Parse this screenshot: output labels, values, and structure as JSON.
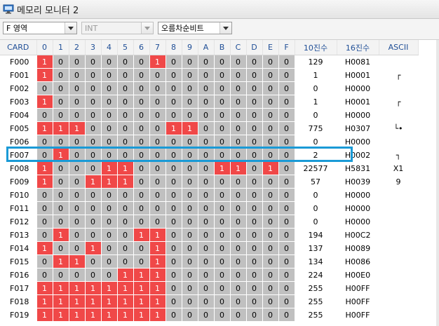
{
  "window": {
    "title": "메모리 모니터 2"
  },
  "toolbar": {
    "area_select": "F 영역",
    "type_select": "INT",
    "sort_select": "오름차순비트"
  },
  "columns": {
    "card": "CARD",
    "bits": [
      "0",
      "1",
      "2",
      "3",
      "4",
      "5",
      "6",
      "7",
      "8",
      "9",
      "A",
      "B",
      "C",
      "D",
      "E",
      "F"
    ],
    "dec": "10진수",
    "hex": "16진수",
    "ascii": "ASCII"
  },
  "rows": [
    {
      "card": "F000",
      "bits": [
        1,
        0,
        0,
        0,
        0,
        0,
        0,
        1,
        0,
        0,
        0,
        0,
        0,
        0,
        0,
        0
      ],
      "dec": "129",
      "hex": "H0081",
      "ascii": ""
    },
    {
      "card": "F001",
      "bits": [
        1,
        0,
        0,
        0,
        0,
        0,
        0,
        0,
        0,
        0,
        0,
        0,
        0,
        0,
        0,
        0
      ],
      "dec": "1",
      "hex": "H0001",
      "ascii": "┌"
    },
    {
      "card": "F002",
      "bits": [
        0,
        0,
        0,
        0,
        0,
        0,
        0,
        0,
        0,
        0,
        0,
        0,
        0,
        0,
        0,
        0
      ],
      "dec": "0",
      "hex": "H0000",
      "ascii": ""
    },
    {
      "card": "F003",
      "bits": [
        1,
        0,
        0,
        0,
        0,
        0,
        0,
        0,
        0,
        0,
        0,
        0,
        0,
        0,
        0,
        0
      ],
      "dec": "1",
      "hex": "H0001",
      "ascii": "┌"
    },
    {
      "card": "F004",
      "bits": [
        0,
        0,
        0,
        0,
        0,
        0,
        0,
        0,
        0,
        0,
        0,
        0,
        0,
        0,
        0,
        0
      ],
      "dec": "0",
      "hex": "H0000",
      "ascii": ""
    },
    {
      "card": "F005",
      "bits": [
        1,
        1,
        1,
        0,
        0,
        0,
        0,
        0,
        1,
        1,
        0,
        0,
        0,
        0,
        0,
        0
      ],
      "dec": "775",
      "hex": "H0307",
      "ascii": "└•"
    },
    {
      "card": "F006",
      "bits": [
        0,
        0,
        0,
        0,
        0,
        0,
        0,
        0,
        0,
        0,
        0,
        0,
        0,
        0,
        0,
        0
      ],
      "dec": "0",
      "hex": "H0000",
      "ascii": ""
    },
    {
      "card": "F007",
      "bits": [
        0,
        1,
        0,
        0,
        0,
        0,
        0,
        0,
        0,
        0,
        0,
        0,
        0,
        0,
        0,
        0
      ],
      "dec": "2",
      "hex": "H0002",
      "ascii": "┐"
    },
    {
      "card": "F008",
      "bits": [
        1,
        0,
        0,
        0,
        1,
        1,
        0,
        0,
        0,
        0,
        0,
        1,
        1,
        0,
        1,
        0
      ],
      "dec": "22577",
      "hex": "H5831",
      "ascii": "X1"
    },
    {
      "card": "F009",
      "bits": [
        1,
        0,
        0,
        1,
        1,
        1,
        0,
        0,
        0,
        0,
        0,
        0,
        0,
        0,
        0,
        0
      ],
      "dec": "57",
      "hex": "H0039",
      "ascii": "9"
    },
    {
      "card": "F010",
      "bits": [
        0,
        0,
        0,
        0,
        0,
        0,
        0,
        0,
        0,
        0,
        0,
        0,
        0,
        0,
        0,
        0
      ],
      "dec": "0",
      "hex": "H0000",
      "ascii": ""
    },
    {
      "card": "F011",
      "bits": [
        0,
        0,
        0,
        0,
        0,
        0,
        0,
        0,
        0,
        0,
        0,
        0,
        0,
        0,
        0,
        0
      ],
      "dec": "0",
      "hex": "H0000",
      "ascii": ""
    },
    {
      "card": "F012",
      "bits": [
        0,
        0,
        0,
        0,
        0,
        0,
        0,
        0,
        0,
        0,
        0,
        0,
        0,
        0,
        0,
        0
      ],
      "dec": "0",
      "hex": "H0000",
      "ascii": ""
    },
    {
      "card": "F013",
      "bits": [
        0,
        1,
        0,
        0,
        0,
        0,
        1,
        1,
        0,
        0,
        0,
        0,
        0,
        0,
        0,
        0
      ],
      "dec": "194",
      "hex": "H00C2",
      "ascii": ""
    },
    {
      "card": "F014",
      "bits": [
        1,
        0,
        0,
        1,
        0,
        0,
        0,
        1,
        0,
        0,
        0,
        0,
        0,
        0,
        0,
        0
      ],
      "dec": "137",
      "hex": "H0089",
      "ascii": ""
    },
    {
      "card": "F015",
      "bits": [
        0,
        1,
        1,
        0,
        0,
        0,
        0,
        1,
        0,
        0,
        0,
        0,
        0,
        0,
        0,
        0
      ],
      "dec": "134",
      "hex": "H0086",
      "ascii": ""
    },
    {
      "card": "F016",
      "bits": [
        0,
        0,
        0,
        0,
        0,
        1,
        1,
        1,
        0,
        0,
        0,
        0,
        0,
        0,
        0,
        0
      ],
      "dec": "224",
      "hex": "H00E0",
      "ascii": ""
    },
    {
      "card": "F017",
      "bits": [
        1,
        1,
        1,
        1,
        1,
        1,
        1,
        1,
        0,
        0,
        0,
        0,
        0,
        0,
        0,
        0
      ],
      "dec": "255",
      "hex": "H00FF",
      "ascii": ""
    },
    {
      "card": "F018",
      "bits": [
        1,
        1,
        1,
        1,
        1,
        1,
        1,
        1,
        0,
        0,
        0,
        0,
        0,
        0,
        0,
        0
      ],
      "dec": "255",
      "hex": "H00FF",
      "ascii": ""
    },
    {
      "card": "F019",
      "bits": [
        1,
        1,
        1,
        1,
        1,
        1,
        1,
        1,
        0,
        0,
        0,
        0,
        0,
        0,
        0,
        0
      ],
      "dec": "255",
      "hex": "H00FF",
      "ascii": ""
    }
  ],
  "selected_row": "F007",
  "colors": {
    "bit_on": "#f04848",
    "bit_off": "#c0c0c0",
    "highlight": "#1a9ad6",
    "header_text": "#1f4e96"
  },
  "icons": {
    "window": "monitor-icon",
    "dropdown": "chevron-down-icon"
  }
}
